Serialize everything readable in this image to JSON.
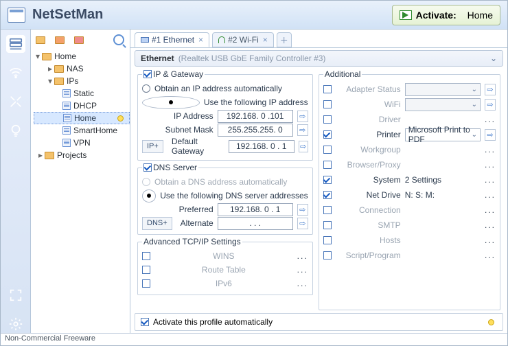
{
  "app_title": "NetSetMan",
  "activate": {
    "label": "Activate:",
    "profile": "Home"
  },
  "tree": {
    "root": "Home",
    "nas": "NAS",
    "ips": "IPs",
    "static": "Static",
    "dhcp": "DHCP",
    "home": "Home",
    "smarthome": "SmartHome",
    "vpn": "VPN",
    "projects": "Projects"
  },
  "tabs": {
    "t1": "#1 Ethernet",
    "t2": "#2 Wi-Fi"
  },
  "adapter": {
    "name": "Ethernet",
    "detail": "(Realtek USB GbE Family Controller #3)"
  },
  "ip": {
    "group": "IP & Gateway",
    "radio_auto": "Obtain an IP address automatically",
    "radio_static": "Use the following IP address",
    "lbl_ip": "IP Address",
    "val_ip": "192.168. 0 .101",
    "lbl_mask": "Subnet Mask",
    "val_mask": "255.255.255. 0",
    "lbl_gw": "Default Gateway",
    "val_gw": "192.168. 0 . 1",
    "btn": "IP+"
  },
  "dns": {
    "group": "DNS Server",
    "radio_auto": "Obtain a DNS address automatically",
    "radio_static": "Use the following DNS server addresses",
    "lbl_pref": "Preferred",
    "val_pref": "192.168. 0 . 1",
    "lbl_alt": "Alternate",
    "val_alt": ".       .       .",
    "btn": "DNS+"
  },
  "adv": {
    "group": "Advanced TCP/IP Settings",
    "wins": "WINS",
    "route": "Route Table",
    "ipv6": "IPv6"
  },
  "add": {
    "group": "Additional",
    "adapter": "Adapter Status",
    "wifi": "WiFi",
    "driver": "Driver",
    "printer": "Printer",
    "printer_val": "Microsoft Print to PDF",
    "workgroup": "Workgroup",
    "proxy": "Browser/Proxy",
    "system": "System",
    "system_val": "2 Settings",
    "netdrive": "Net Drive",
    "netdrive_val": "N: S: M:",
    "connection": "Connection",
    "smtp": "SMTP",
    "hosts": "Hosts",
    "script": "Script/Program"
  },
  "autoact": "Activate this profile automatically",
  "status": "Non-Commercial Freeware"
}
